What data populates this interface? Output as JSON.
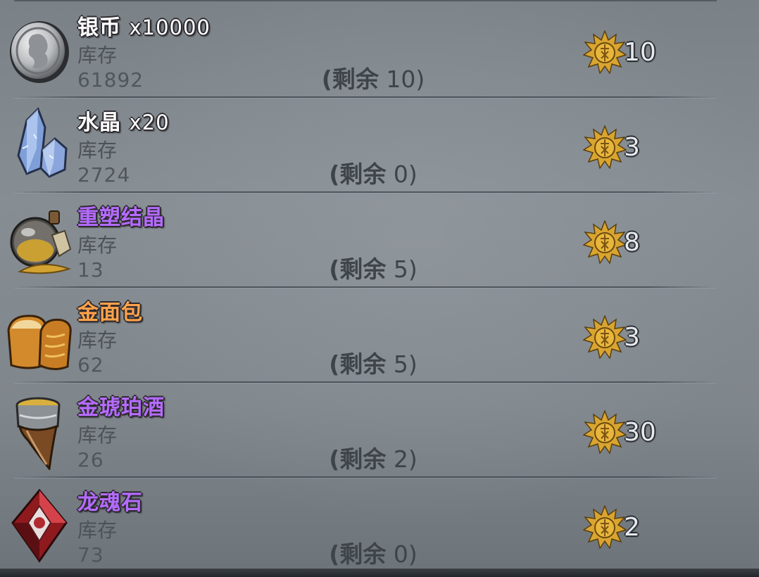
{
  "stock_label": "库存",
  "remain_prefix": "(剩余",
  "remain_suffix": ")",
  "items": [
    {
      "name": "银币",
      "qty": "x10000",
      "name_color": "#ffffff",
      "stock": "61892",
      "remain": "10",
      "price": "10",
      "icon": "silver-coin-icon"
    },
    {
      "name": "水晶",
      "qty": "x20",
      "name_color": "#ffffff",
      "stock": "2724",
      "remain": "0",
      "price": "3",
      "icon": "crystal-icon"
    },
    {
      "name": "重塑结晶",
      "qty": "",
      "name_color": "#b56bff",
      "stock": "13",
      "remain": "5",
      "price": "8",
      "icon": "reshape-crystal-icon"
    },
    {
      "name": "金面包",
      "qty": "",
      "name_color": "#ffa24a",
      "stock": "62",
      "remain": "5",
      "price": "3",
      "icon": "golden-bread-icon"
    },
    {
      "name": "金琥珀酒",
      "qty": "",
      "name_color": "#b56bff",
      "stock": "26",
      "remain": "2",
      "price": "30",
      "icon": "golden-amber-wine-icon"
    },
    {
      "name": "龙魂石",
      "qty": "",
      "name_color": "#b56bff",
      "stock": "73",
      "remain": "0",
      "price": "2",
      "icon": "dragon-soul-stone-icon"
    }
  ],
  "price_currency_icon": "gold-medal-icon"
}
